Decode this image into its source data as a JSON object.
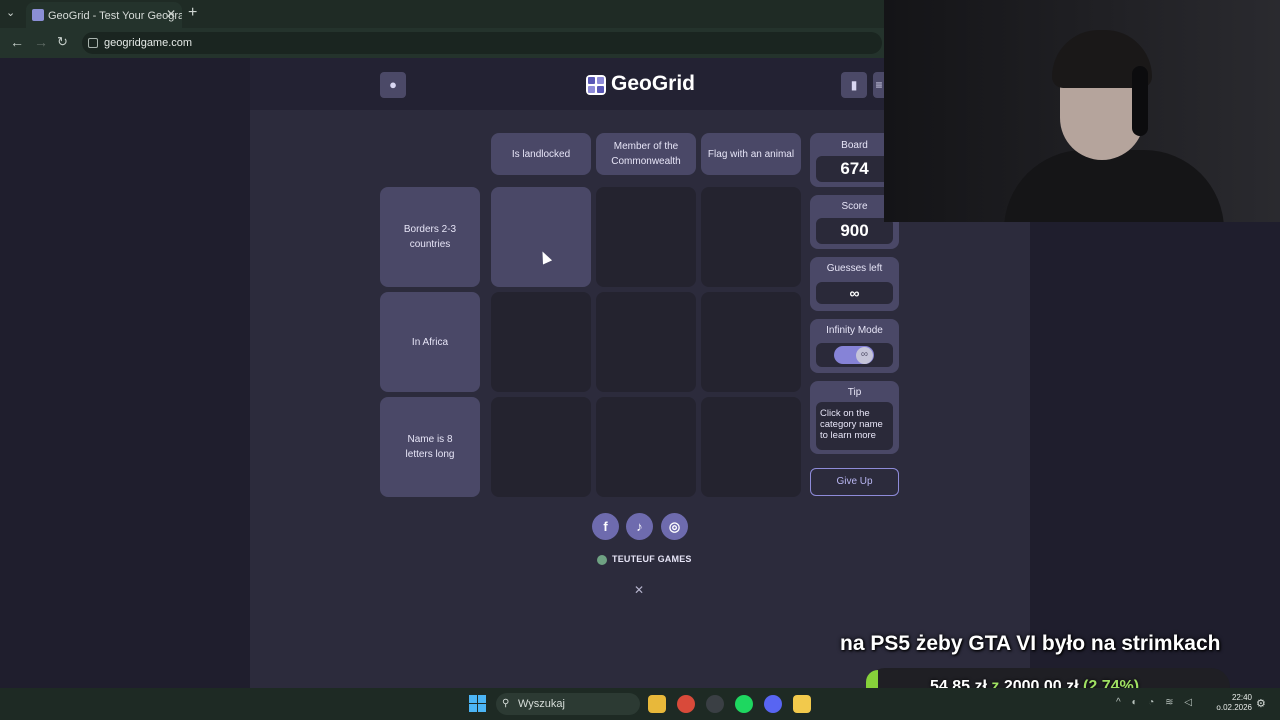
{
  "browser": {
    "tab_title": "GeoGrid - Test Your Geography",
    "url": "geogridgame.com",
    "new_tab_icon": "plus-icon",
    "close_icon": "close-icon"
  },
  "app": {
    "logo_text": "GeoGrid",
    "accent_color": "#8e8bd9"
  },
  "grid": {
    "columns": [
      "Is landlocked",
      "Member of the Commonwealth",
      "Flag with an animal"
    ],
    "rows": [
      "Borders 2-3 countries",
      "In Africa",
      "Name is 8 letters long"
    ]
  },
  "sidebar": {
    "board_label": "Board",
    "board_value": "674",
    "score_label": "Score",
    "score_value": "900",
    "guesses_label": "Guesses left",
    "guesses_value": "∞",
    "infinity_label": "Infinity Mode",
    "infinity_enabled": true,
    "tip_label": "Tip",
    "tip_text": "Click on the category name to learn more",
    "give_up_label": "Give Up"
  },
  "footer": {
    "brand": "TEUTEUF GAMES",
    "socials": [
      "facebook-icon",
      "tiktok-icon",
      "instagram-icon"
    ]
  },
  "overlay": {
    "donation_message": "na PS5 żeby GTA VI było na strimkach",
    "donation_current": "54,85 zł",
    "donation_sep": "z",
    "donation_goal": "2000,00 zł",
    "donation_percent": "(2.74%)",
    "donation_progress": 0.0274
  },
  "taskbar": {
    "search_placeholder": "Wyszukaj",
    "time": "22:40",
    "date": "o.02.2026"
  }
}
